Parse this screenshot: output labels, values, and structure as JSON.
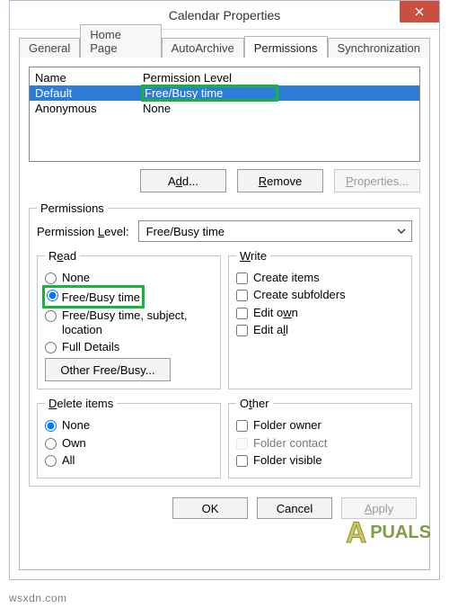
{
  "window": {
    "title": "Calendar Properties"
  },
  "tabs": {
    "general": "General",
    "homepage": "Home Page",
    "autoarchive": "AutoArchive",
    "permissions": "Permissions",
    "sync": "Synchronization"
  },
  "list": {
    "header_name": "Name",
    "header_perm": "Permission Level",
    "rows": [
      {
        "name": "Default",
        "perm": "Free/Busy time"
      },
      {
        "name": "Anonymous",
        "perm": "None"
      }
    ]
  },
  "buttons": {
    "add": "Add...",
    "remove": "Remove",
    "properties": "Properties...",
    "other_freebusy": "Other Free/Busy...",
    "ok": "OK",
    "cancel": "Cancel",
    "apply": "Apply"
  },
  "groups": {
    "permissions": "Permissions",
    "read": "Read",
    "write": "Write",
    "delete": "Delete items",
    "other": "Other"
  },
  "level": {
    "label": "Permission Level:",
    "value": "Free/Busy time"
  },
  "read": {
    "none": "None",
    "freebusy": "Free/Busy time",
    "freebusy_detail": "Free/Busy time, subject, location",
    "full": "Full Details"
  },
  "write": {
    "create_items": "Create items",
    "create_subfolders": "Create subfolders",
    "edit_own": "Edit own",
    "edit_all": "Edit all"
  },
  "delete": {
    "none": "None",
    "own": "Own",
    "all": "All"
  },
  "other": {
    "folder_owner": "Folder owner",
    "folder_contact": "Folder contact",
    "folder_visible": "Folder visible"
  },
  "watermark": {
    "url": "wsxdn.com",
    "logo_a": "A",
    "logo_text": "PUALS"
  }
}
